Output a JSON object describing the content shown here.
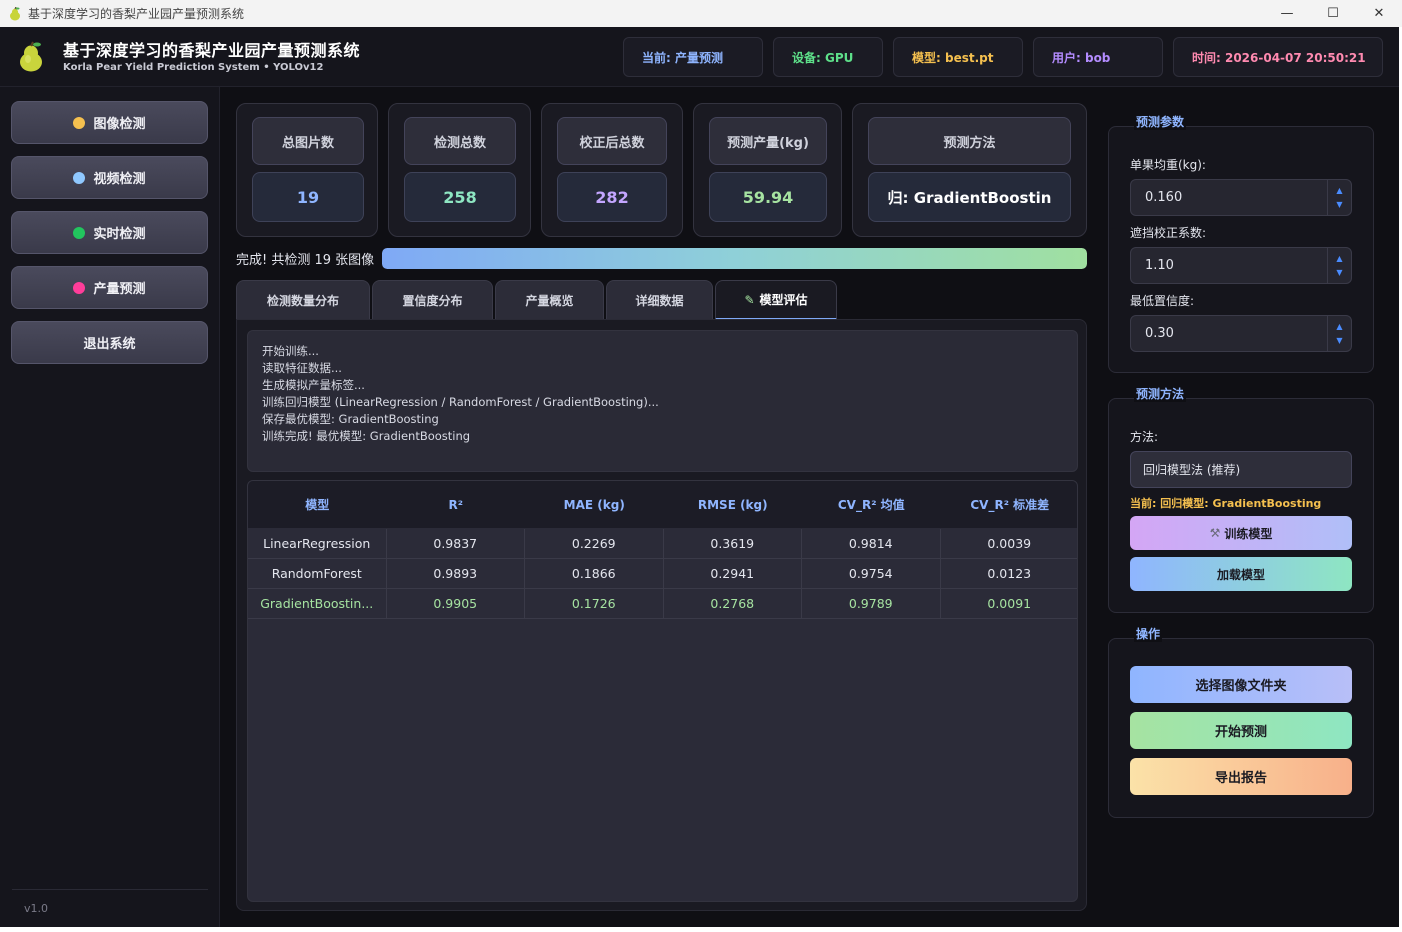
{
  "window": {
    "title": "基于深度学习的香梨产业园产量预测系统",
    "controls": [
      "—",
      "☐",
      "✕"
    ]
  },
  "header": {
    "title": "基于深度学习的香梨产业园产量预测系统",
    "subtitle": "Korla Pear Yield Prediction System • YOLOv12",
    "chips": {
      "current": "当前: 产量预测",
      "device": "设备: GPU",
      "model": "模型: best.pt",
      "user": "用户: bob",
      "time": "时间: 2026-04-07 20:50:21"
    }
  },
  "sidebar": {
    "items": [
      {
        "label": "图像检测",
        "dot_color": "#f5c04f"
      },
      {
        "label": "视频检测",
        "dot_color": "#8fc8ff"
      },
      {
        "label": "实时检测",
        "dot_color": "#22c55e"
      },
      {
        "label": "产量预测",
        "dot_color": "#ff3d9a"
      },
      {
        "label": "退出系统"
      }
    ],
    "version": "v1.0"
  },
  "stats": {
    "total_images": {
      "label": "总图片数",
      "value": "19",
      "color": "#8fb5ff"
    },
    "total_detections": {
      "label": "检测总数",
      "value": "258",
      "color": "#8ee6c2"
    },
    "corrected_total": {
      "label": "校正后总数",
      "value": "282",
      "color": "#c4a6ff"
    },
    "predicted_yield": {
      "label": "预测产量(kg)",
      "value": "59.94",
      "color": "#a6e3a1"
    },
    "method": {
      "label": "预测方法",
      "value": "归: GradientBoostin",
      "color": "#ffffff"
    }
  },
  "progress": {
    "label": "完成! 共检测 19 张图像",
    "percent": 100
  },
  "tabs": [
    {
      "label": "检测数量分布"
    },
    {
      "label": "置信度分布"
    },
    {
      "label": "产量概览"
    },
    {
      "label": "详细数据"
    },
    {
      "label": "模型评估",
      "icon": "pencil-icon",
      "active": true
    }
  ],
  "log": [
    "开始训练...",
    "读取特征数据...",
    "生成模拟产量标签...",
    "训练回归模型 (LinearRegression / RandomForest / GradientBoosting)...",
    "保存最优模型: GradientBoosting",
    "训练完成! 最优模型: GradientBoosting"
  ],
  "table": {
    "columns": [
      "模型",
      "R²",
      "MAE (kg)",
      "RMSE (kg)",
      "CV_R² 均值",
      "CV_R² 标准差"
    ],
    "rows": [
      [
        "LinearRegression",
        "0.9837",
        "0.2269",
        "0.3619",
        "0.9814",
        "0.0039"
      ],
      [
        "RandomForest",
        "0.9893",
        "0.1866",
        "0.2941",
        "0.9754",
        "0.0123"
      ],
      [
        "GradientBoostin...",
        "0.9905",
        "0.1726",
        "0.2768",
        "0.9789",
        "0.0091"
      ]
    ],
    "best_row_color": "#a6e3a1"
  },
  "params": {
    "title": "预测参数",
    "unit_weight": {
      "label": "单果均重(kg):",
      "value": "0.160"
    },
    "occlusion": {
      "label": "遮挡校正系数:",
      "value": "1.10"
    },
    "min_conf": {
      "label": "最低置信度:",
      "value": "0.30"
    },
    "arrow_up": "▲",
    "arrow_down": "▼"
  },
  "method_group": {
    "title": "预测方法",
    "label": "方法:",
    "selected": "回归模型法 (推荐)",
    "current": "当前: 回归模型: GradientBoosting",
    "train_button": "训练模型",
    "load_button": "加载模型"
  },
  "actions": {
    "title": "操作",
    "select_folder": "选择图像文件夹",
    "start": "开始预测",
    "export": "导出报告"
  }
}
